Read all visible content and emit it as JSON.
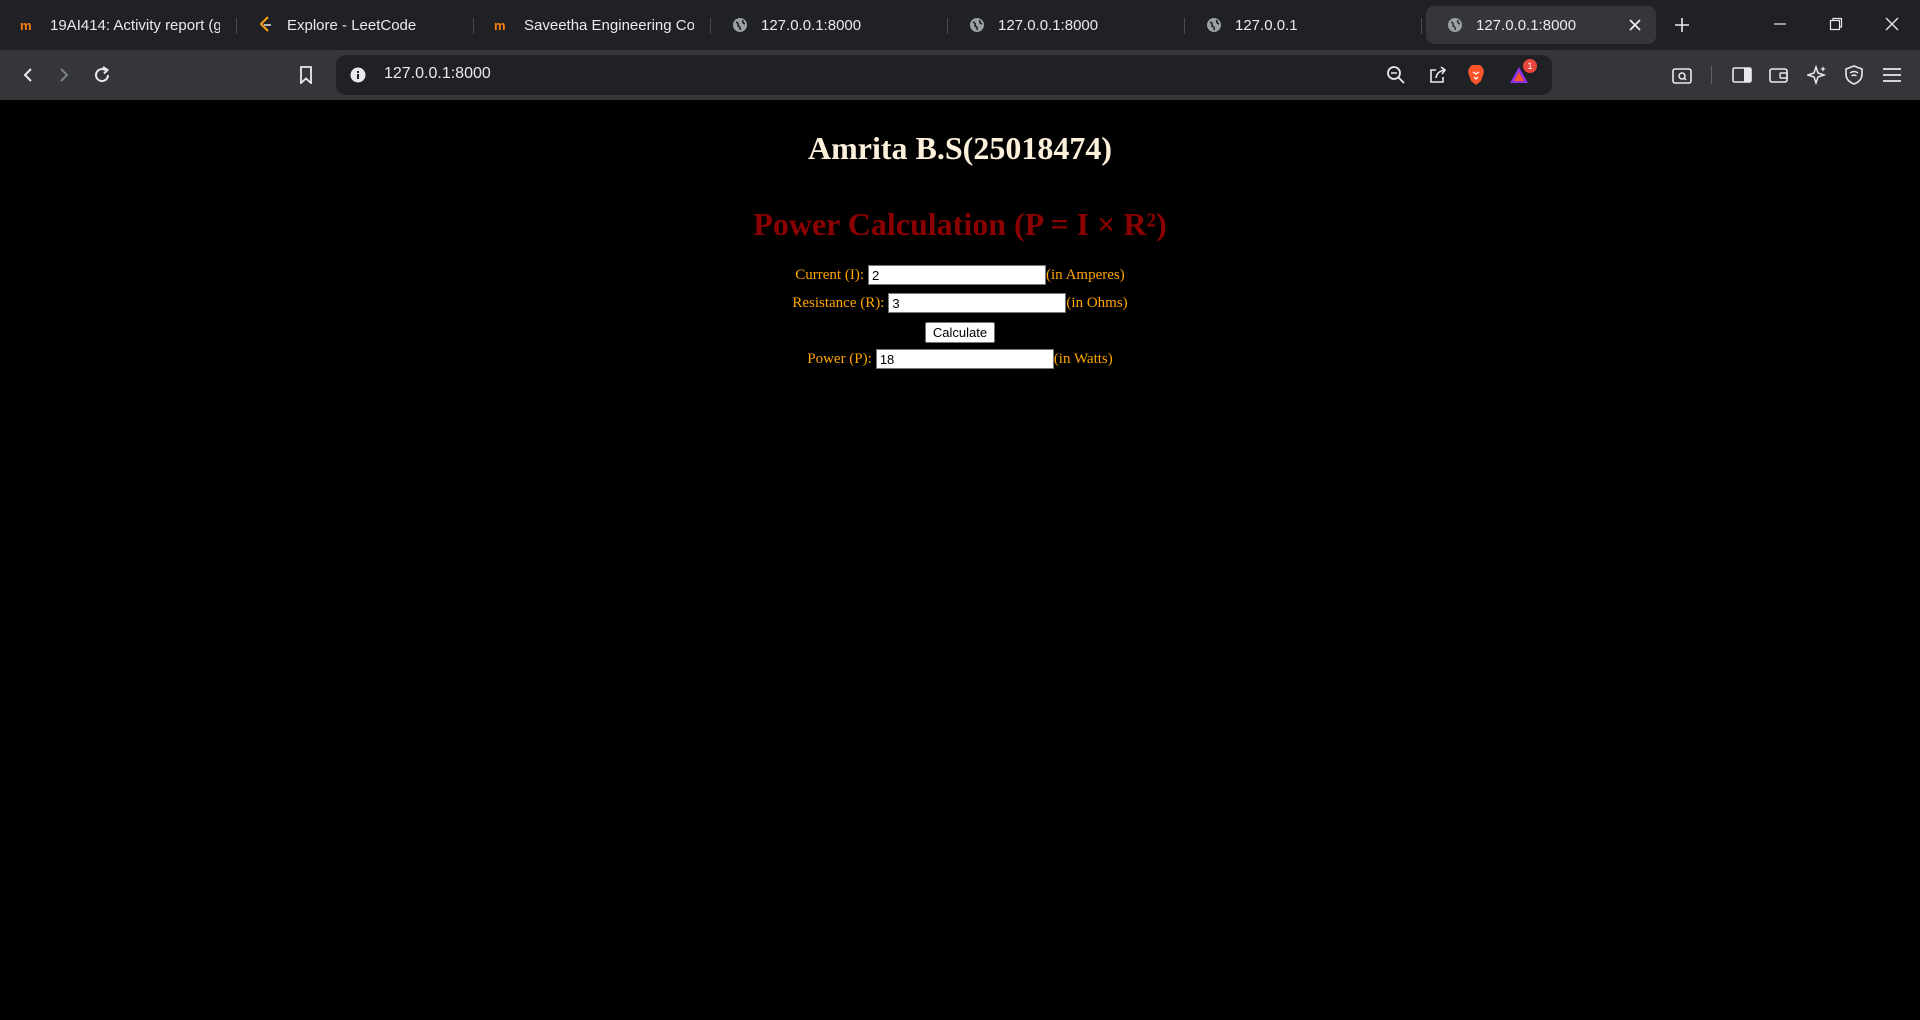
{
  "browser": {
    "tabs": [
      {
        "title": "19AI414: Activity report (g",
        "icon": "moodle-icon"
      },
      {
        "title": "Explore - LeetCode",
        "icon": "leetcode-icon"
      },
      {
        "title": "Saveetha Engineering Coll",
        "icon": "moodle-icon"
      },
      {
        "title": "127.0.0.1:8000",
        "icon": "globe-icon"
      },
      {
        "title": "127.0.0.1:8000",
        "icon": "globe-icon"
      },
      {
        "title": "127.0.0.1",
        "icon": "globe-icon"
      },
      {
        "title": "127.0.0.1:8000",
        "icon": "globe-icon",
        "active": true
      }
    ],
    "address": "127.0.0.1:8000",
    "rewards_badge_count": "1",
    "accent_color": "#fb542b"
  },
  "page": {
    "author": "Amrita B.S(25018474)",
    "title": "Power Calculation (P = I × R²)",
    "current": {
      "label": "Current (I):",
      "value": "2",
      "unit": "(in Amperes)"
    },
    "resistance": {
      "label": "Resistance (R):",
      "value": "3",
      "unit": "(in Ohms)"
    },
    "calculate_label": "Calculate",
    "power": {
      "label": "Power (P):",
      "value": "18",
      "unit": "(in Watts)"
    },
    "colors": {
      "background": "#000000",
      "author": "#fdf1dc",
      "title": "#8b0000",
      "labels": "#ffa500"
    }
  }
}
